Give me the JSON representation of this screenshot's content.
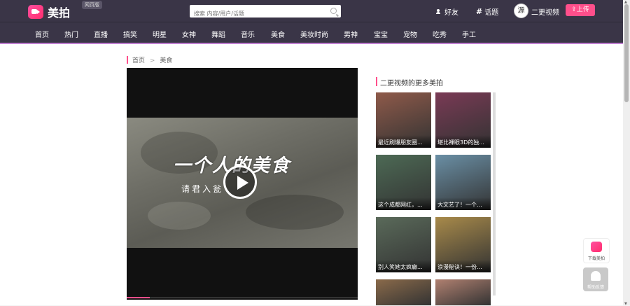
{
  "header": {
    "logo_text": "美拍",
    "badge": "网页版",
    "search_placeholder": "搜索 内容/用户/话题",
    "friends": "好友",
    "topics": "话题",
    "avatar_char": "源",
    "username": "二更视频",
    "upload": "上传"
  },
  "nav": [
    "首页",
    "热门",
    "直播",
    "搞笑",
    "明星",
    "女神",
    "舞蹈",
    "音乐",
    "美食",
    "美妆时尚",
    "男神",
    "宝宝",
    "宠物",
    "吃秀",
    "手工"
  ],
  "breadcrumb": {
    "home": "首页",
    "sep": ">",
    "current": "美食"
  },
  "video": {
    "title_calligraphy": "一个人的美食",
    "subtitle": "请君入瓮",
    "progress": 0.1
  },
  "sidebar": {
    "title": "二更视频的更多美拍",
    "items": [
      {
        "caption": "最近刷爆朋友圈...",
        "color": "#8f5a4a"
      },
      {
        "caption": "堪比裸眼3D的独...",
        "color": "#7a3a55"
      },
      {
        "caption": "这个成都网红，...",
        "color": "#4d6a55"
      },
      {
        "caption": "大文艺了！一个...",
        "color": "#6a8fa5"
      },
      {
        "caption": "别人笑她太疯癫...",
        "color": "#5a6a5a"
      },
      {
        "caption": "浪漫秘诀！一份...",
        "color": "#a88a4a"
      },
      {
        "caption": "",
        "color": "#8a6a4a"
      },
      {
        "caption": "",
        "color": "#b08070"
      }
    ]
  },
  "float": {
    "download": "下载美拍",
    "help": "帮助反馈"
  }
}
